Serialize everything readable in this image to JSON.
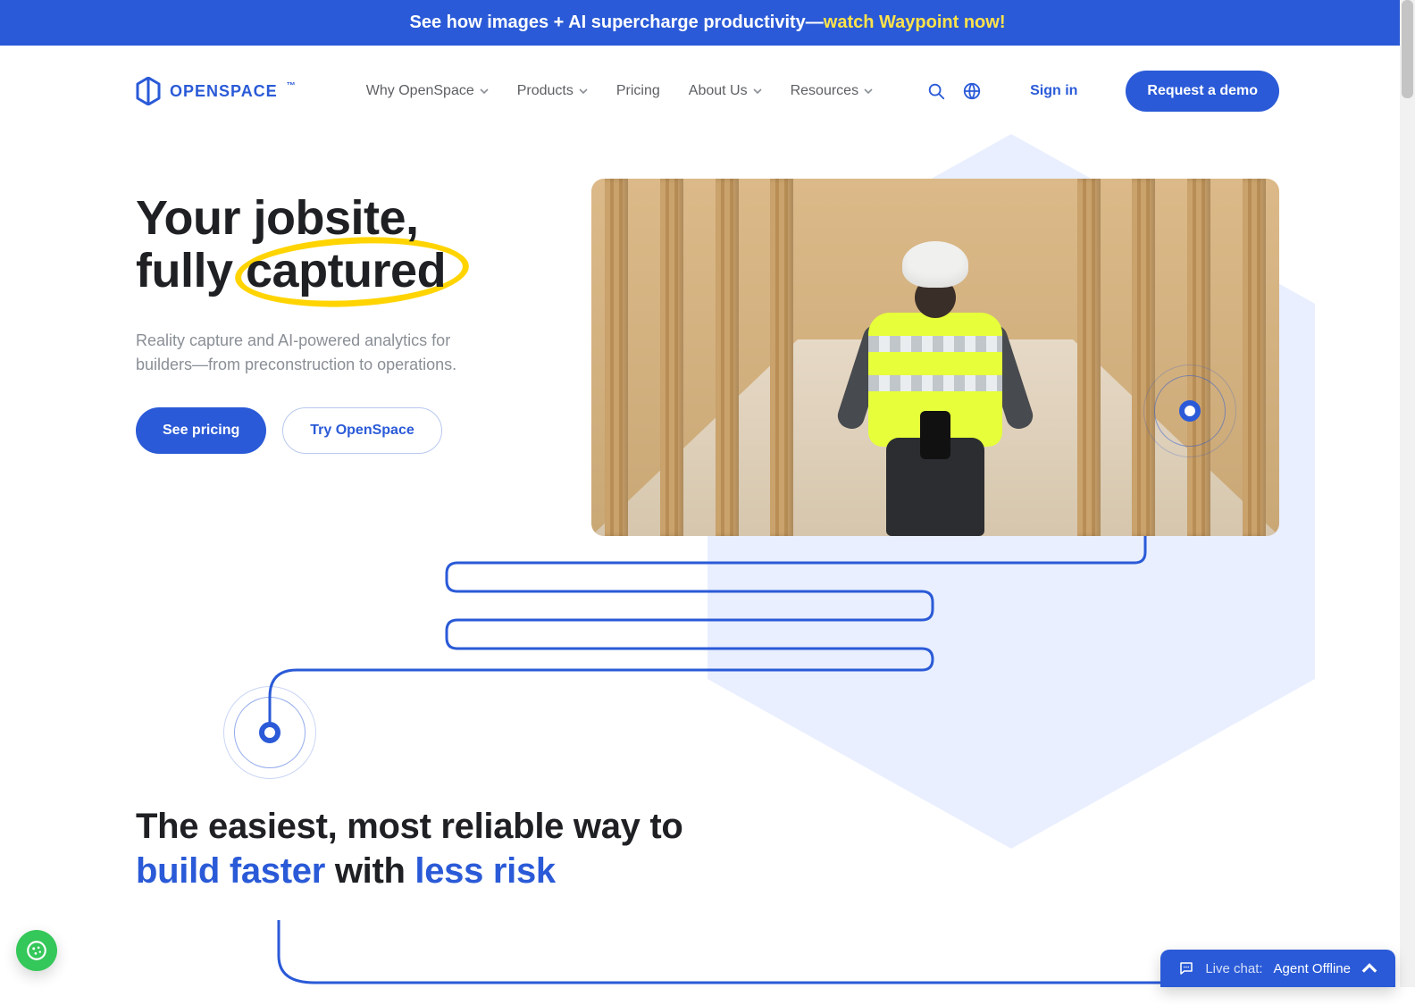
{
  "announcement": {
    "prefix": "See how images + AI supercharge productivity—",
    "cta": "watch Waypoint now!"
  },
  "brand": {
    "name": "OPENSPACE"
  },
  "nav": {
    "items": [
      {
        "label": "Why OpenSpace",
        "dropdown": true
      },
      {
        "label": "Products",
        "dropdown": true
      },
      {
        "label": "Pricing",
        "dropdown": false
      },
      {
        "label": "About Us",
        "dropdown": true
      },
      {
        "label": "Resources",
        "dropdown": true
      }
    ],
    "signin": "Sign in",
    "demo": "Request a demo"
  },
  "hero": {
    "title_line1": "Your jobsite,",
    "title_line2_prefix": "fully ",
    "title_line2_highlight": "captured",
    "subtitle": "Reality capture and AI-powered analytics for builders—from preconstruction to operations.",
    "cta_primary": "See pricing",
    "cta_secondary": "Try OpenSpace"
  },
  "section2": {
    "line1": "The easiest, most reliable way to",
    "blue1": "build faster",
    "mid": " with ",
    "blue2": "less risk"
  },
  "chat": {
    "prefix": "Live chat:",
    "status": "Agent Offline"
  }
}
